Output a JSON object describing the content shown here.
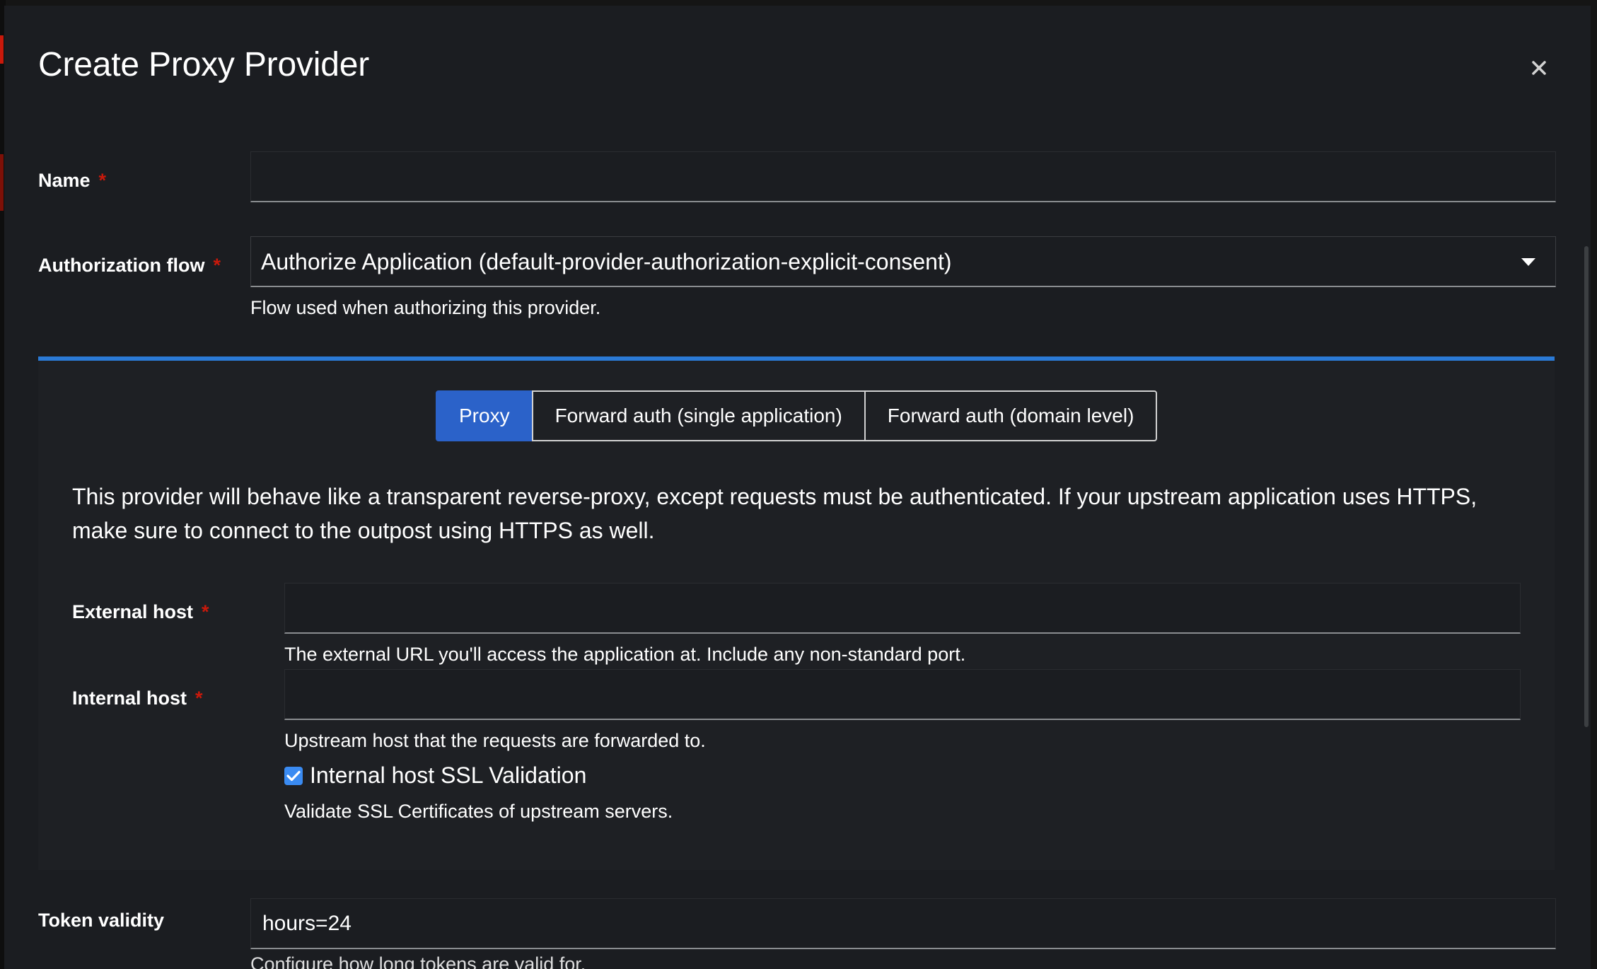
{
  "modal": {
    "title": "Create Proxy Provider",
    "close_icon": "close-icon"
  },
  "fields": {
    "name": {
      "label": "Name",
      "required_mark": "*",
      "value": ""
    },
    "authorization_flow": {
      "label": "Authorization flow",
      "required_mark": "*",
      "selected": "Authorize Application (default-provider-authorization-explicit-consent)",
      "helper": "Flow used when authorizing this provider."
    }
  },
  "mode_toggle": {
    "options": [
      {
        "label": "Proxy",
        "active": true
      },
      {
        "label": "Forward auth (single application)",
        "active": false
      },
      {
        "label": "Forward auth (domain level)",
        "active": false
      }
    ]
  },
  "proxy_section": {
    "description": "This provider will behave like a transparent reverse-proxy, except requests must be authenticated. If your upstream application uses HTTPS, make sure to connect to the outpost using HTTPS as well.",
    "external_host": {
      "label": "External host",
      "required_mark": "*",
      "value": "",
      "helper": "The external URL you'll access the application at. Include any non-standard port."
    },
    "internal_host": {
      "label": "Internal host",
      "required_mark": "*",
      "value": "",
      "helper": "Upstream host that the requests are forwarded to."
    },
    "ssl_validation": {
      "label": "Internal host SSL Validation",
      "checked": true,
      "helper": "Validate SSL Certificates of upstream servers."
    }
  },
  "token_validity": {
    "label": "Token validity",
    "value": "hours=24",
    "helper_partial": "Configure how long tokens are valid for."
  },
  "colors": {
    "accent": "#2b62c9",
    "divider": "#2b7ad6",
    "required": "#c9190b",
    "background": "#1b1d21",
    "panel": "#1e2024"
  }
}
